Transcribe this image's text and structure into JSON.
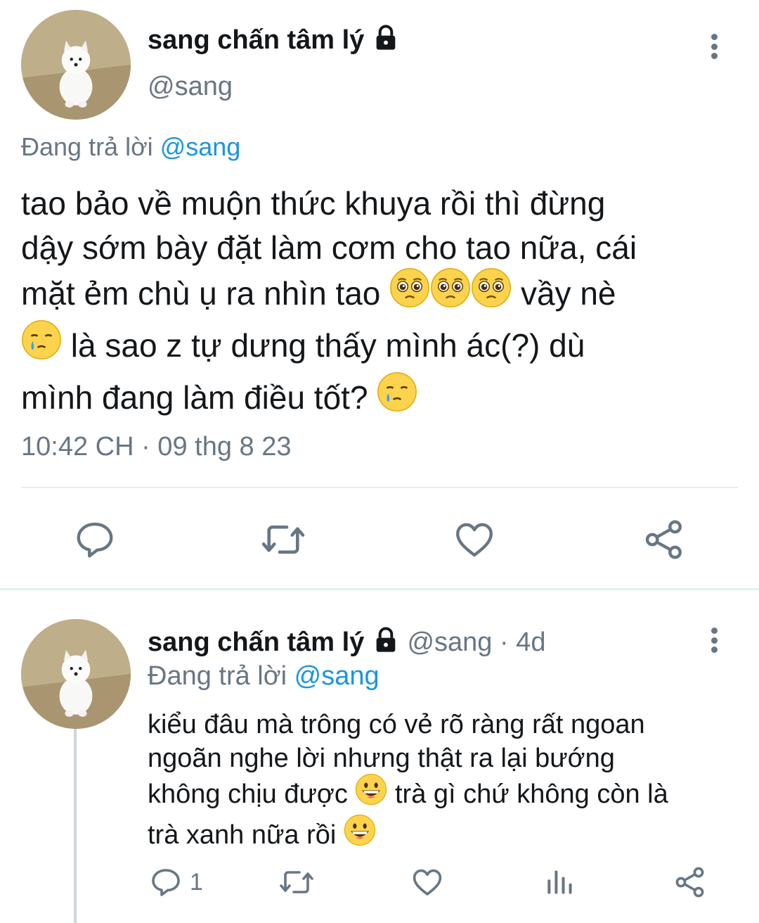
{
  "main_tweet": {
    "author_name": "sang chấn tâm lý",
    "handle": "@sang",
    "reply_prefix": "Đang trả lời",
    "reply_to": "@sang",
    "text_lines": [
      "tao bảo về muộn thức khuya rồi thì đừng",
      "dậy sớm bày đặt làm cơm cho tao nữa, cái",
      "mặt ẻm chù ụ ra nhìn tao",
      "vầy nè",
      "là sao z tự dưng thấy mình ác(?) dù",
      "mình đang làm điều tốt?"
    ],
    "timestamp": "10:42 CH · 09 thg 8 23"
  },
  "reply_tweet": {
    "author_name": "sang chấn tâm lý",
    "handle": "@sang",
    "separator": "·",
    "age": "4d",
    "reply_prefix": "Đang trả lời",
    "reply_to": "@sang",
    "text_lines": [
      "kiểu đâu mà trông có vẻ rõ ràng rất ngoan",
      "ngoãn nghe lời nhưng thật ra lại bướng",
      "không chịu được",
      "trà gì chứ không còn là",
      "trà xanh nữa rồi"
    ],
    "reply_count": "1"
  },
  "icons": {
    "lock": "lock-icon",
    "more": "more-vertical-icon",
    "reply": "reply-icon",
    "retweet": "retweet-icon",
    "like": "heart-icon",
    "share": "share-icon",
    "analytics": "analytics-icon",
    "pleading": "pleading-face-emoji",
    "crying": "crying-face-emoji",
    "grinning": "grinning-squint-emoji"
  },
  "colors": {
    "link": "#1b95e0",
    "secondary": "#687684",
    "divider": "#e6ecf0"
  }
}
